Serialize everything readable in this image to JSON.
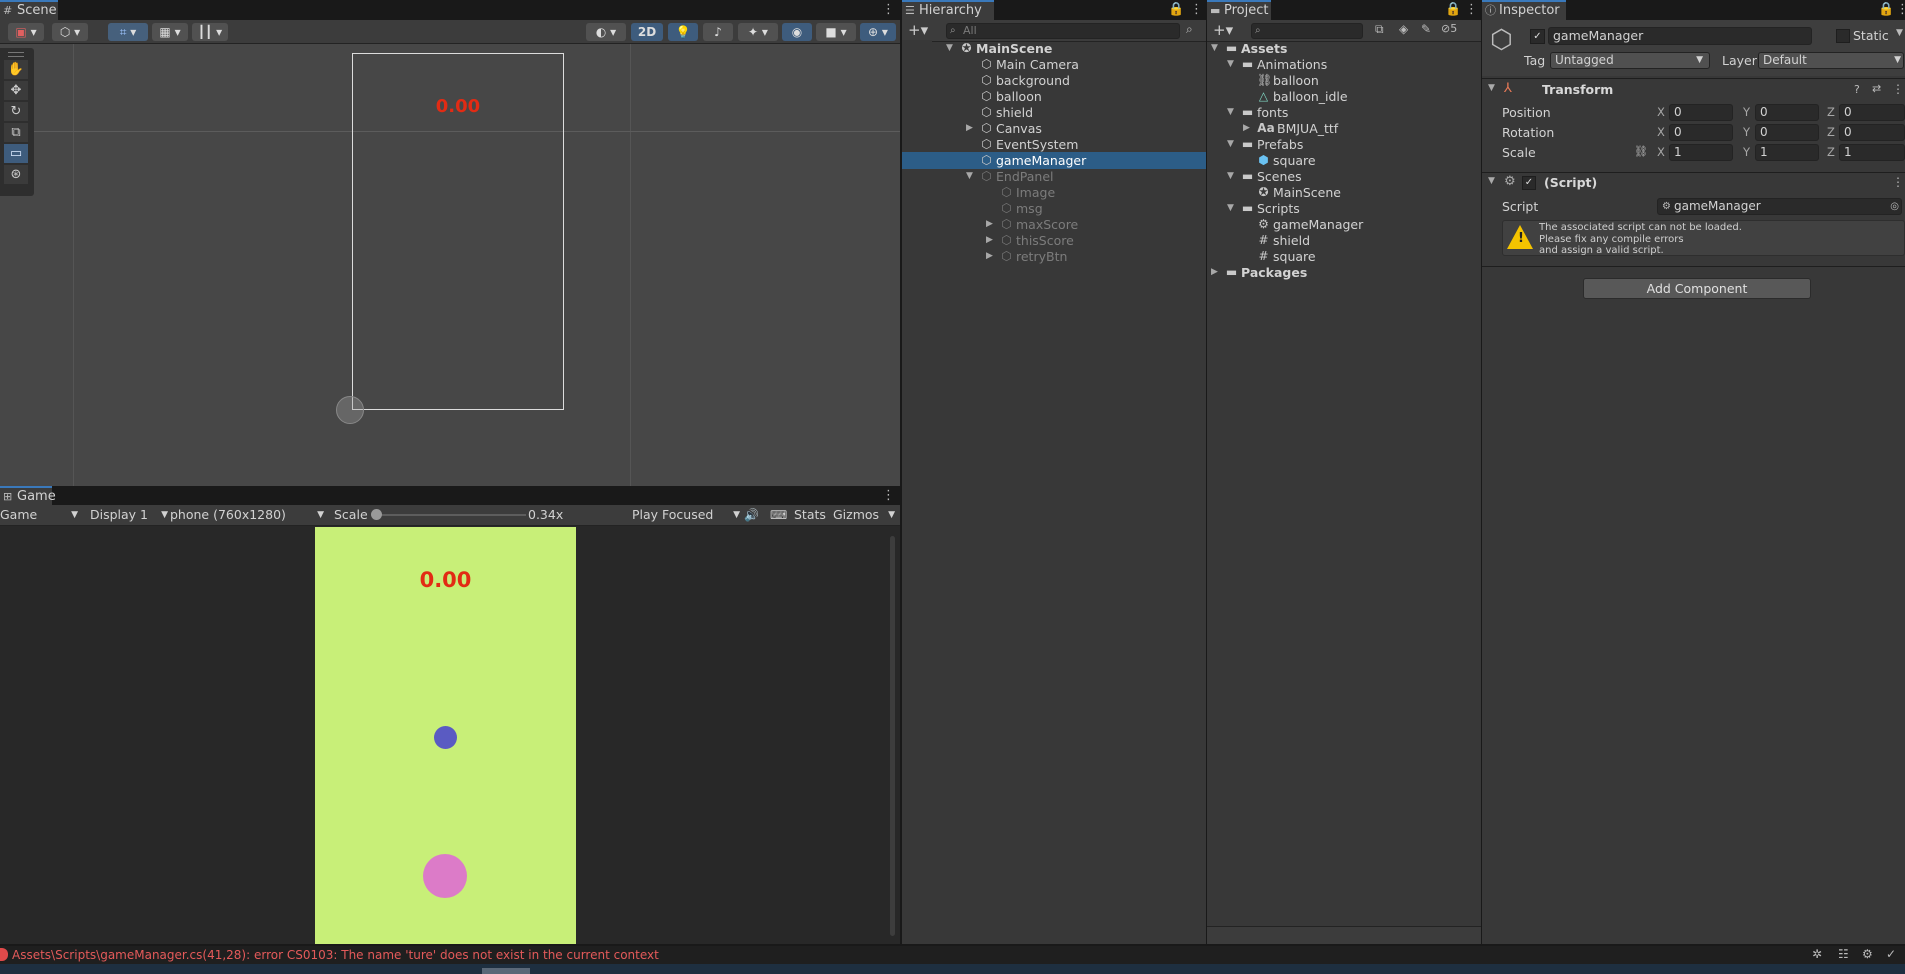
{
  "scene": {
    "tab": "Scene",
    "score_overlay": "0.00",
    "toolbar": {
      "mode_2d": "2D"
    }
  },
  "game": {
    "tab": "Game",
    "view_select": "Game",
    "display_select": "Display 1",
    "resolution_select": "phone (760x1280)",
    "scale_label": "Scale",
    "scale_value": "0.34x",
    "scale_fraction": 0.0,
    "play_mode": "Play Focused",
    "stats_label": "Stats",
    "gizmos_label": "Gizmos",
    "score_text": "0.00",
    "colors": {
      "background": "#c8ef78",
      "score": "#e22b14",
      "shield": "#5a5bc2",
      "balloon": "#dc7bc8"
    }
  },
  "hierarchy": {
    "tab": "Hierarchy",
    "search_placeholder": "All",
    "items": [
      {
        "label": "MainScene",
        "depth": 0,
        "icon": "unity-scene-icon",
        "expanded": true,
        "bold": true
      },
      {
        "label": "Main Camera",
        "depth": 1,
        "icon": "gameobject-cube-icon"
      },
      {
        "label": "background",
        "depth": 1,
        "icon": "gameobject-cube-icon"
      },
      {
        "label": "balloon",
        "depth": 1,
        "icon": "gameobject-cube-icon"
      },
      {
        "label": "shield",
        "depth": 1,
        "icon": "gameobject-cube-icon"
      },
      {
        "label": "Canvas",
        "depth": 1,
        "icon": "gameobject-cube-icon",
        "collapsed": true
      },
      {
        "label": "EventSystem",
        "depth": 1,
        "icon": "gameobject-cube-icon"
      },
      {
        "label": "gameManager",
        "depth": 1,
        "icon": "gameobject-cube-icon",
        "selected": true
      },
      {
        "label": "EndPanel",
        "depth": 1,
        "icon": "gameobject-cube-icon",
        "expanded": true,
        "inactive": true
      },
      {
        "label": "Image",
        "depth": 2,
        "icon": "gameobject-cube-icon",
        "inactive": true
      },
      {
        "label": "msg",
        "depth": 2,
        "icon": "gameobject-cube-icon",
        "inactive": true
      },
      {
        "label": "maxScore",
        "depth": 2,
        "icon": "gameobject-cube-icon",
        "collapsed": true,
        "inactive": true
      },
      {
        "label": "thisScore",
        "depth": 2,
        "icon": "gameobject-cube-icon",
        "collapsed": true,
        "inactive": true
      },
      {
        "label": "retryBtn",
        "depth": 2,
        "icon": "gameobject-cube-icon",
        "collapsed": true,
        "inactive": true
      }
    ]
  },
  "project": {
    "tab": "Project",
    "hidden_count": "5",
    "items": [
      {
        "label": "Assets",
        "depth": 0,
        "icon": "folder-icon",
        "expanded": true,
        "bold": true
      },
      {
        "label": "Animations",
        "depth": 1,
        "icon": "folder-icon",
        "expanded": true
      },
      {
        "label": "balloon",
        "depth": 2,
        "icon": "animator-controller-icon"
      },
      {
        "label": "balloon_idle",
        "depth": 2,
        "icon": "animation-clip-icon"
      },
      {
        "label": "fonts",
        "depth": 1,
        "icon": "folder-icon",
        "expanded": true
      },
      {
        "label": "BMJUA_ttf",
        "depth": 2,
        "icon": "font-icon",
        "glyph": "Aa",
        "collapsed": true
      },
      {
        "label": "Prefabs",
        "depth": 1,
        "icon": "folder-icon",
        "expanded": true
      },
      {
        "label": "square",
        "depth": 2,
        "icon": "prefab-icon"
      },
      {
        "label": "Scenes",
        "depth": 1,
        "icon": "folder-icon",
        "expanded": true
      },
      {
        "label": "MainScene",
        "depth": 2,
        "icon": "unity-scene-icon"
      },
      {
        "label": "Scripts",
        "depth": 1,
        "icon": "folder-icon",
        "expanded": true
      },
      {
        "label": "gameManager",
        "depth": 2,
        "icon": "gear-icon"
      },
      {
        "label": "shield",
        "depth": 2,
        "icon": "csharp-script-icon",
        "glyph": "#"
      },
      {
        "label": "square",
        "depth": 2,
        "icon": "csharp-script-icon",
        "glyph": "#"
      },
      {
        "label": "Packages",
        "depth": 0,
        "icon": "folder-icon",
        "collapsed": true,
        "bold": true
      }
    ]
  },
  "inspector": {
    "tab": "Inspector",
    "object_name": "gameManager",
    "static_label": "Static",
    "tag_label": "Tag",
    "tag_value": "Untagged",
    "layer_label": "Layer",
    "layer_value": "Default",
    "transform": {
      "title": "Transform",
      "rows": [
        {
          "label": "Position",
          "x": "0",
          "y": "0",
          "z": "0"
        },
        {
          "label": "Rotation",
          "x": "0",
          "y": "0",
          "z": "0"
        },
        {
          "label": "Scale",
          "x": "1",
          "y": "1",
          "z": "1"
        }
      ],
      "axis_x": "X",
      "axis_y": "Y",
      "axis_z": "Z"
    },
    "script_component": {
      "title": "(Script)",
      "script_label": "Script",
      "script_value": "gameManager",
      "warning_line1": "The associated script can not be loaded.",
      "warning_line2": "Please fix any compile errors",
      "warning_line3": "and assign a valid script."
    },
    "add_component": "Add Component"
  },
  "status_bar": {
    "error_message": "Assets\\Scripts\\gameManager.cs(41,28): error CS0103: The name 'ture' does not exist in the current context",
    "error_color": "#e45a5a"
  }
}
